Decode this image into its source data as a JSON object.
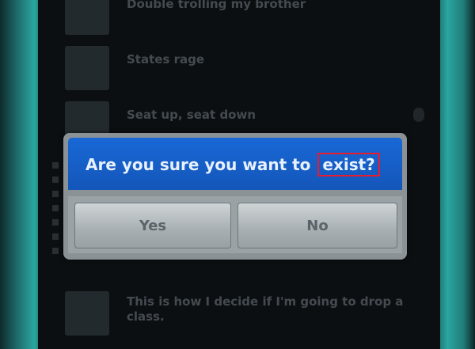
{
  "list": {
    "items": [
      {
        "title": "Double trolling my brother",
        "subtitle": ""
      },
      {
        "title": "States rage",
        "subtitle": ""
      },
      {
        "title": "Seat up, seat down",
        "subtitle": ""
      },
      {
        "title": "This is how I decide if I'm going to drop a class.",
        "subtitle": ""
      }
    ]
  },
  "dialog": {
    "title_prefix": "Are you sure you want to",
    "title_highlight": "exist?",
    "yes_label": "Yes",
    "no_label": "No"
  },
  "colors": {
    "dialog_title_bg": "#1868d6",
    "highlight_border": "#e81c2c",
    "bezel": "#2aa6a0"
  }
}
